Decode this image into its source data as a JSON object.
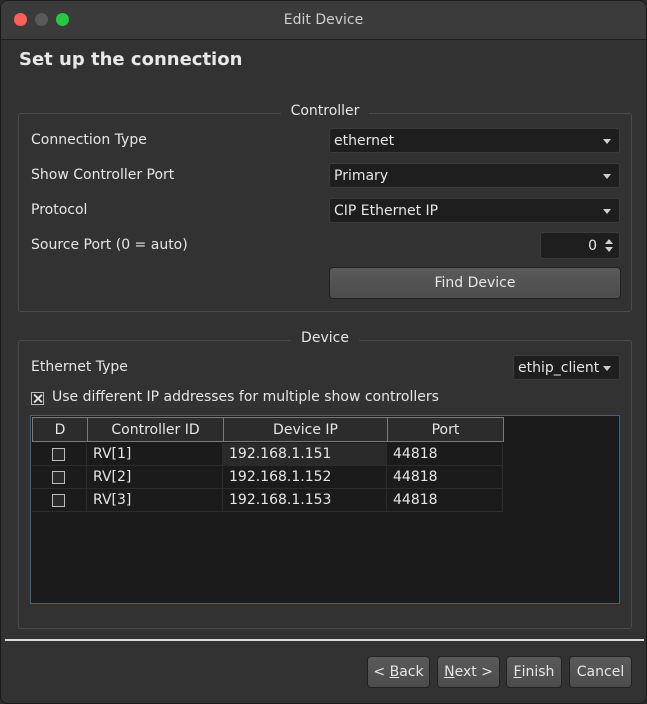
{
  "window": {
    "title": "Edit Device",
    "close_color": "#fe5f57",
    "minimize_color": "#5a5a5a",
    "maximize_color": "#28c840"
  },
  "heading": "Set up the connection",
  "controller": {
    "title": "Controller",
    "connection_type_label": "Connection Type",
    "connection_type_value": "ethernet",
    "show_port_label": "Show Controller Port",
    "show_port_value": "Primary",
    "protocol_label": "Protocol",
    "protocol_value": "CIP Ethernet IP",
    "source_port_label": "Source Port (0 = auto)",
    "source_port_value": "0",
    "find_device_label": "Find Device"
  },
  "device": {
    "title": "Device",
    "ethernet_type_label": "Ethernet Type",
    "ethernet_type_value": "ethip_client",
    "multi_ip_label": "Use different IP addresses for multiple show controllers",
    "multi_ip_checked": true,
    "table": {
      "headers": [
        "D",
        "Controller ID",
        "Device IP",
        "Port"
      ],
      "rows": [
        {
          "d": false,
          "controller_id": "RV[1]",
          "device_ip": "192.168.1.151",
          "port": "44818"
        },
        {
          "d": false,
          "controller_id": "RV[2]",
          "device_ip": "192.168.1.152",
          "port": "44818"
        },
        {
          "d": false,
          "controller_id": "RV[3]",
          "device_ip": "192.168.1.153",
          "port": "44818"
        }
      ]
    }
  },
  "footer": {
    "back_prefix": "< ",
    "back_mnemonic": "B",
    "back_rest": "ack",
    "next_mnemonic": "N",
    "next_rest": "ext >",
    "finish_mnemonic": "F",
    "finish_rest": "inish",
    "cancel_label": "Cancel"
  }
}
